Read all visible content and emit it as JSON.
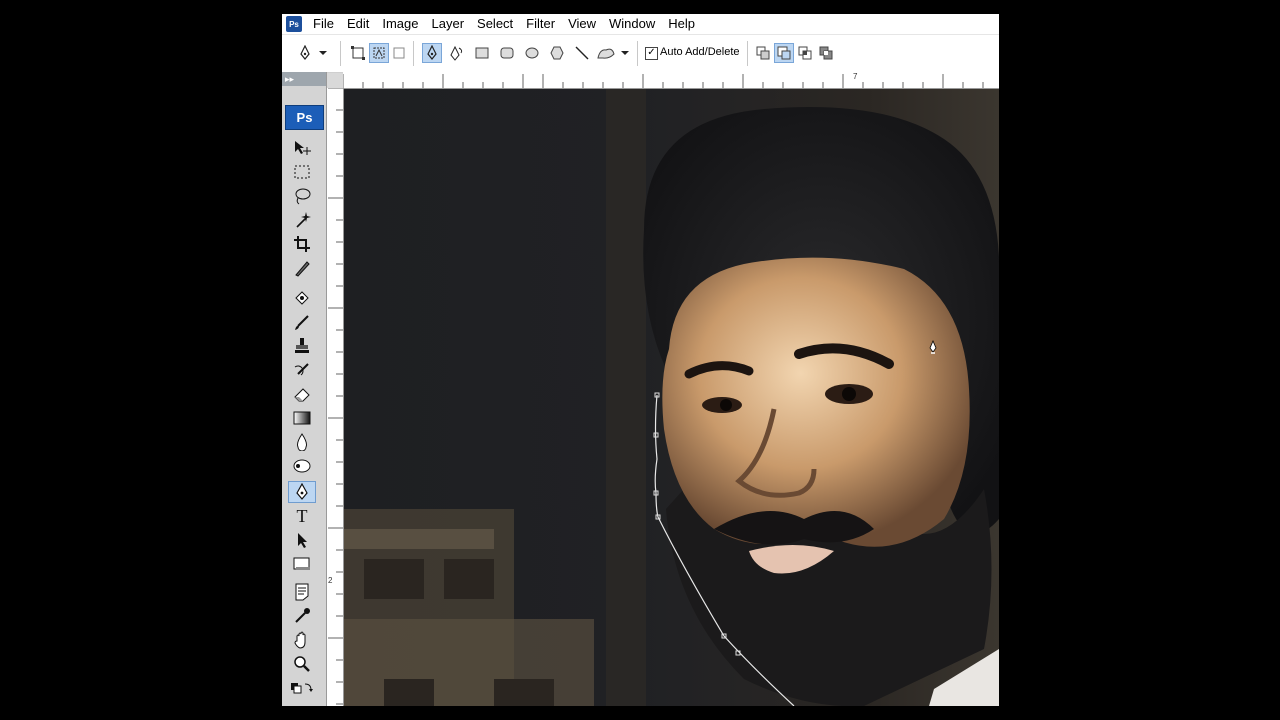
{
  "app": {
    "logo_text": "Ps"
  },
  "menu": [
    "File",
    "Edit",
    "Image",
    "Layer",
    "Select",
    "Filter",
    "View",
    "Window",
    "Help"
  ],
  "options_bar": {
    "auto_add_delete_checked": true,
    "auto_add_delete_label": "Auto Add/Delete",
    "icons": [
      "pen-tool-preset-icon",
      "shape-layers-icon",
      "paths-icon",
      "fill-pixels-icon",
      "pen-icon",
      "freeform-pen-icon",
      "rectangle-icon",
      "rounded-rectangle-icon",
      "ellipse-icon",
      "polygon-icon",
      "line-icon",
      "custom-shape-icon",
      "add-to-path-area-icon",
      "subtract-from-path-area-icon",
      "intersect-path-areas-icon",
      "exclude-overlapping-path-areas-icon"
    ]
  },
  "rulers": {
    "top_labels": [
      "7"
    ],
    "left_labels": [
      "2"
    ]
  },
  "toolbox": {
    "badge_text": "Ps",
    "grip_text": "▸▸",
    "tools": [
      "move-icon",
      "marquee-icon",
      "lasso-icon",
      "magic-wand-icon",
      "crop-icon",
      "slice-icon",
      "healing-brush-icon",
      "brush-icon",
      "clone-stamp-icon",
      "history-brush-icon",
      "eraser-icon",
      "gradient-icon",
      "blur-icon",
      "dodge-icon",
      "pen-icon",
      "type-icon",
      "path-selection-icon",
      "shape-icon",
      "notes-icon",
      "eyedropper-icon",
      "hand-icon",
      "zoom-icon",
      "color-swap-icon"
    ],
    "active_tool": "pen-icon"
  },
  "colors": {
    "selection": "#bcd6f2",
    "ps_blue": "#1c5eb8"
  }
}
